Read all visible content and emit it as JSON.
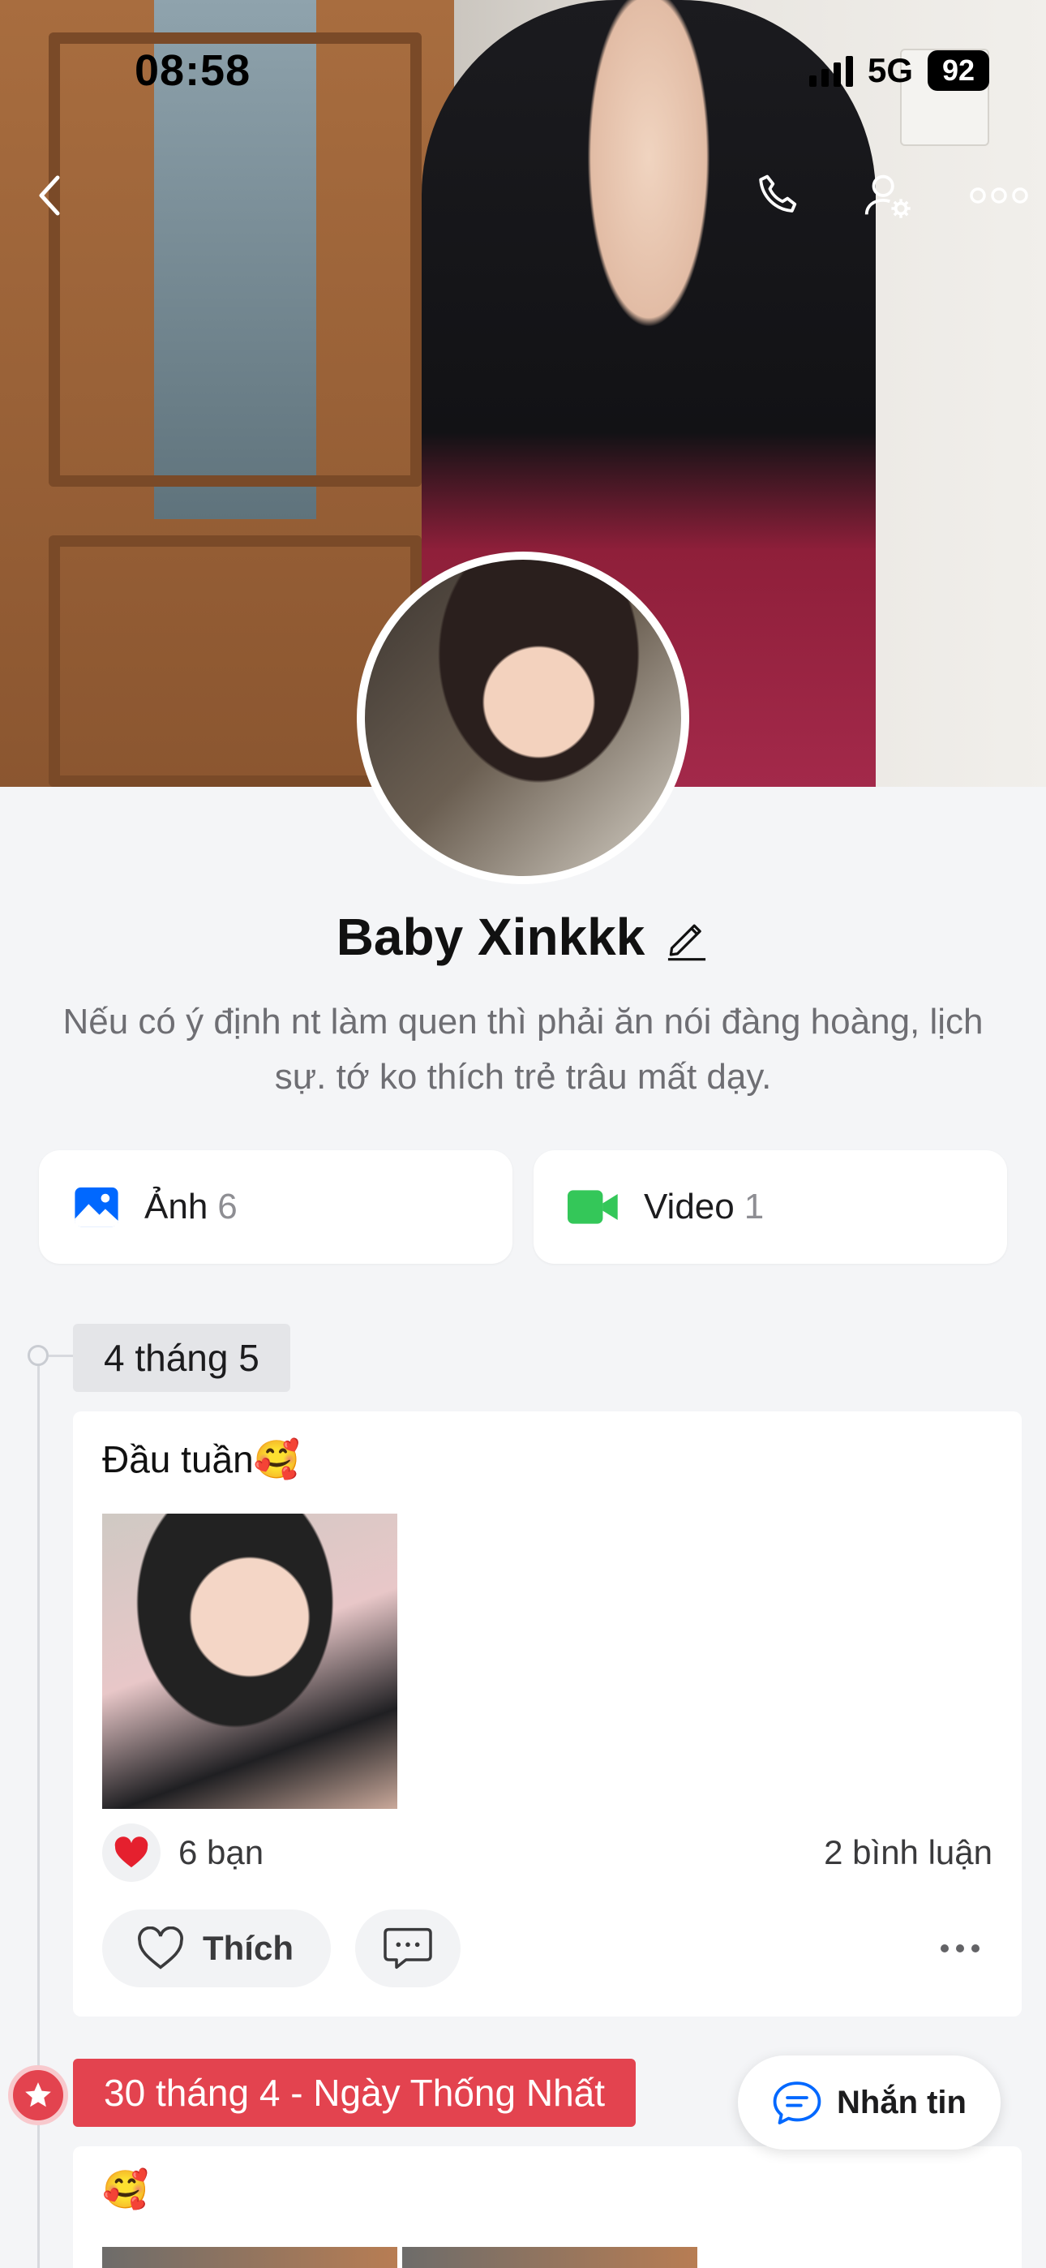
{
  "status": {
    "time": "08:58",
    "network": "5G",
    "battery": "92"
  },
  "nav": {
    "back": "chevron-left-icon",
    "call": "phone-icon",
    "settings": "user-settings-icon",
    "more": "more-horizontal-icon"
  },
  "profile": {
    "name": "Baby Xinkkk",
    "bio": "Nếu có ý định nt làm quen thì phải ăn nói đàng hoàng, lịch sự. tớ ko thích trẻ trâu mất dạy."
  },
  "media": {
    "photos": {
      "label": "Ảnh",
      "count": "6"
    },
    "videos": {
      "label": "Video",
      "count": "1"
    }
  },
  "timeline": [
    {
      "date": "4 tháng 5",
      "text": "Đầu tuần🥰",
      "reactions": "6 bạn",
      "comments": "2 bình luận",
      "like_label": "Thích"
    },
    {
      "date": "30 tháng 4 - Ngày Thống Nhất",
      "text": "🥰"
    }
  ],
  "chat_button": {
    "label": "Nhắn tin"
  },
  "colors": {
    "accent_blue": "#0068ff",
    "video_green": "#34c759",
    "holiday_red": "#e3434f",
    "heart_red": "#e5202e"
  }
}
